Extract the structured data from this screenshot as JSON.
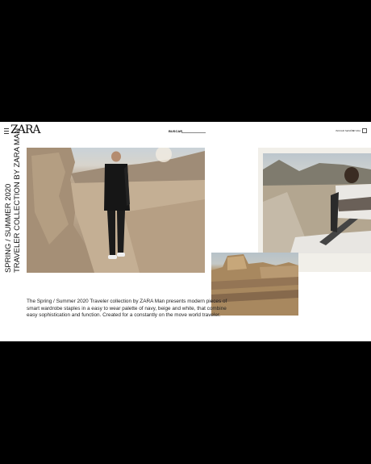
{
  "header": {
    "logo": "ZARA",
    "search_label": "BUSCAR",
    "login_label": "INICIAR SESIÓN",
    "help_label": "AYUDA"
  },
  "hero": {
    "title_line1": "SPRING / SUMMER 2020",
    "title_line2": "TRAVELER COLLECTION BY ZARA MAN"
  },
  "description": "The Spring / Summer 2020 Traveler collection by ZARA Man presents modern pieces of smart wardrobe staples in a easy to wear palette of navy, beige and white, that combine easy sophistication and function. Created for a constantly on the move world traveler.",
  "icons": {
    "menu": "hamburger-icon",
    "bag": "shopping-bag-icon"
  }
}
